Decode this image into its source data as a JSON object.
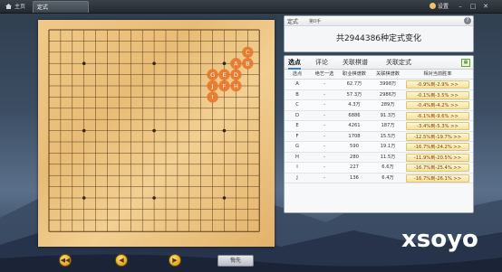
{
  "titlebar": {
    "home_tab": "主页",
    "active_tab": "定式",
    "settings_label": "设置"
  },
  "header": {
    "label": "定式",
    "move_info": "第0手",
    "summary": "共2944386种定式变化"
  },
  "panel": {
    "tabs": [
      "选点",
      "评论",
      "关联棋谱",
      "关联定式"
    ],
    "columns": [
      "选点",
      "绝艺一选",
      "职业棋谱数",
      "关联棋谱数",
      "相对当前胜率"
    ],
    "rows": [
      {
        "point": "A",
        "ai": "-",
        "pro": "62.7万",
        "related": "3998万",
        "rate": "-0.9%到-2.9% >>"
      },
      {
        "point": "B",
        "ai": "-",
        "pro": "57.3万",
        "related": "2986万",
        "rate": "-0.1%到-3.5% >>"
      },
      {
        "point": "C",
        "ai": "-",
        "pro": "4.3万",
        "related": "289万",
        "rate": "-0.4%到-4.2% >>"
      },
      {
        "point": "D",
        "ai": "-",
        "pro": "6886",
        "related": "91.3万",
        "rate": "-6.1%到-9.6% >>"
      },
      {
        "point": "E",
        "ai": "-",
        "pro": "4261",
        "related": "187万",
        "rate": "-3.4%到-5.3% >>"
      },
      {
        "point": "F",
        "ai": "-",
        "pro": "1708",
        "related": "15.5万",
        "rate": "-12.5%到-19.7% >>"
      },
      {
        "point": "G",
        "ai": "-",
        "pro": "590",
        "related": "19.1万",
        "rate": "-16.7%到-24.2% >>"
      },
      {
        "point": "H",
        "ai": "-",
        "pro": "280",
        "related": "11.5万",
        "rate": "-11.9%到-20.5% >>"
      },
      {
        "point": "I",
        "ai": "-",
        "pro": "227",
        "related": "6.6万",
        "rate": "-16.7%到-25.4% >>"
      },
      {
        "point": "J",
        "ai": "-",
        "pro": "136",
        "related": "6.4万",
        "rate": "-16.7%到-26.1% >>"
      }
    ]
  },
  "board": {
    "size": 19,
    "markers": [
      {
        "label": "C",
        "col": 17,
        "row": 2
      },
      {
        "label": "A",
        "col": 16,
        "row": 3
      },
      {
        "label": "B",
        "col": 17,
        "row": 3
      },
      {
        "label": "G",
        "col": 14,
        "row": 4
      },
      {
        "label": "E",
        "col": 15,
        "row": 4
      },
      {
        "label": "D",
        "col": 16,
        "row": 4
      },
      {
        "label": "J",
        "col": 14,
        "row": 5
      },
      {
        "label": "F",
        "col": 15,
        "row": 5
      },
      {
        "label": "H",
        "col": 16,
        "row": 5
      },
      {
        "label": "I",
        "col": 14,
        "row": 6
      }
    ],
    "marker_color": "#e8762a"
  },
  "controls": {
    "undo_label": "悔先",
    "first_icon": "fast-back-icon",
    "prev_icon": "prev-icon",
    "next_icon": "next-icon"
  },
  "watermark": "xsoyo"
}
